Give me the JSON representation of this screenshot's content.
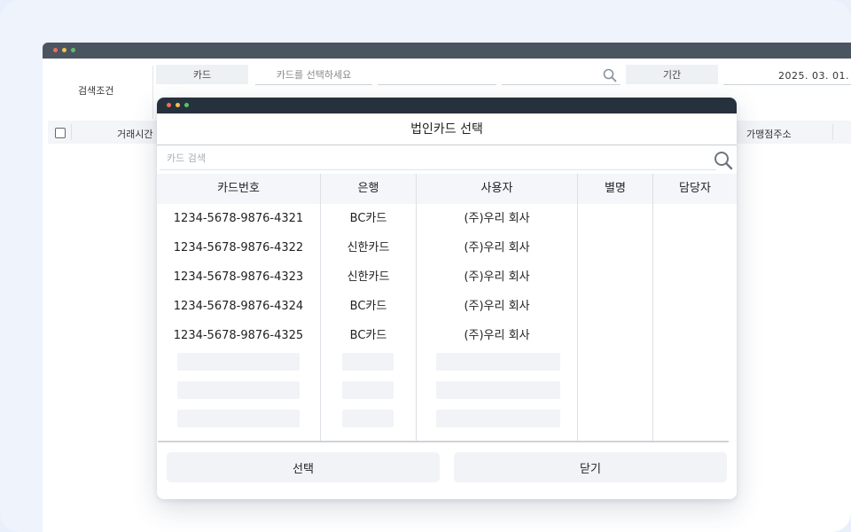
{
  "background_window": {
    "search_condition_label": "검색조건",
    "card_chip_label": "카드",
    "card_select_placeholder": "카드를 선택하세요",
    "period_chip_label": "기간",
    "period_start": "2025. 03. 01.",
    "table_headers": {
      "time": "거래시간",
      "merchant_address": "가맹점주소"
    }
  },
  "modal": {
    "title": "법인카드 선택",
    "search_placeholder": "카드 검색",
    "columns": [
      "카드번호",
      "은행",
      "사용자",
      "별명",
      "담당자"
    ],
    "rows": [
      {
        "card_number": "1234-5678-9876-4321",
        "bank": "BC카드",
        "user": "(주)우리 회사",
        "nickname": "",
        "manager": ""
      },
      {
        "card_number": "1234-5678-9876-4322",
        "bank": "신한카드",
        "user": "(주)우리 회사",
        "nickname": "",
        "manager": ""
      },
      {
        "card_number": "1234-5678-9876-4323",
        "bank": "신한카드",
        "user": "(주)우리 회사",
        "nickname": "",
        "manager": ""
      },
      {
        "card_number": "1234-5678-9876-4324",
        "bank": "BC카드",
        "user": "(주)우리 회사",
        "nickname": "",
        "manager": ""
      },
      {
        "card_number": "1234-5678-9876-4325",
        "bank": "BC카드",
        "user": "(주)우리 회사",
        "nickname": "",
        "manager": ""
      }
    ],
    "buttons": {
      "select": "선택",
      "close": "닫기"
    }
  },
  "colors": {
    "modal_titlebar": "#25323d",
    "bg_titlebar": "#4a5561",
    "header_bg": "#f4f6f9",
    "placeholder_bg": "#f1f3f7",
    "dot_red": "#f26b5b",
    "dot_yellow": "#f5c14e",
    "dot_green": "#58c26a"
  }
}
